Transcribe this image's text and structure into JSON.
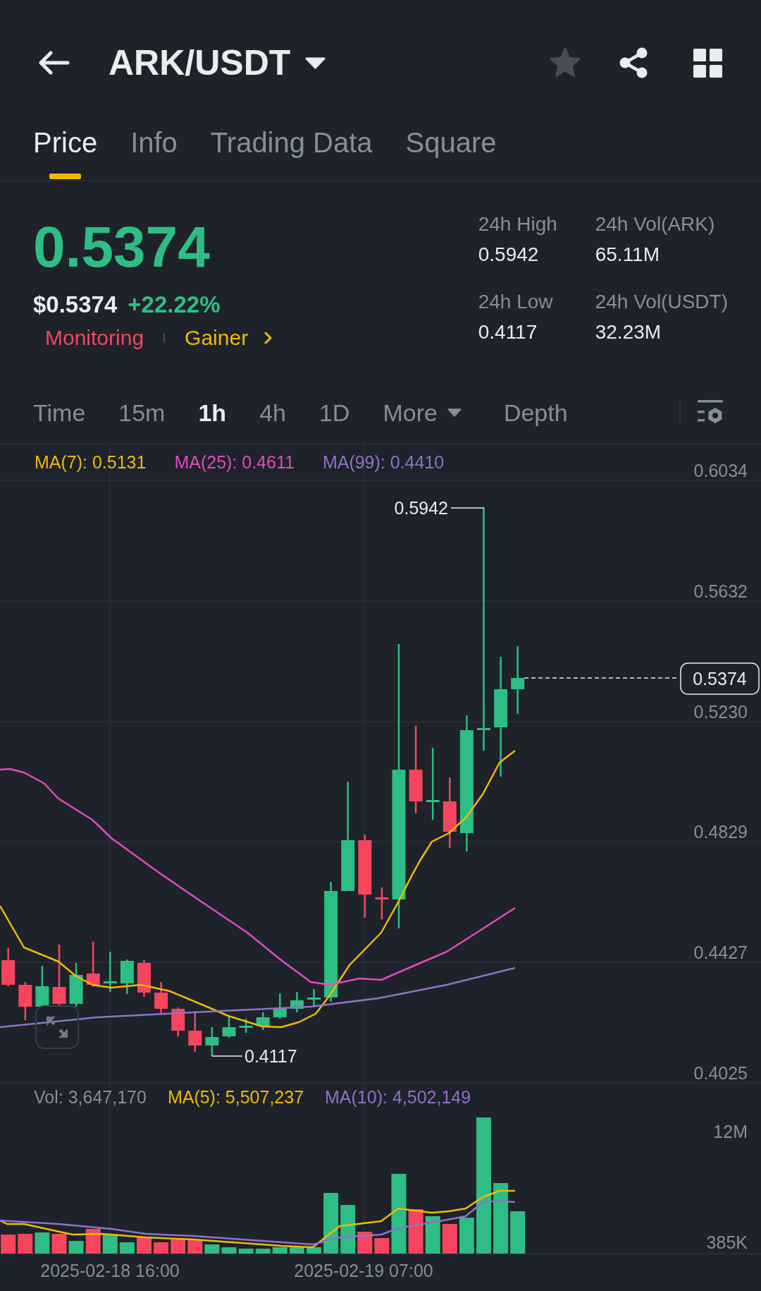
{
  "header": {
    "title": "ARK/USDT",
    "favorite": false
  },
  "tabs": [
    {
      "label": "Price",
      "selected": true
    },
    {
      "label": "Info",
      "selected": false
    },
    {
      "label": "Trading Data",
      "selected": false
    },
    {
      "label": "Square",
      "selected": false
    }
  ],
  "ticker": {
    "last_price": "0.5374",
    "usd_price": "$0.5374",
    "change": "+22.22%",
    "tags": [
      {
        "label": "Monitoring",
        "color": "#f6465d",
        "kind": "tag"
      },
      {
        "label": "Gainer",
        "color": "#f0b90b",
        "kind": "link"
      }
    ]
  },
  "stats": [
    {
      "label": "24h High",
      "value": "0.5942"
    },
    {
      "label": "24h Vol(ARK)",
      "value": "65.11M"
    },
    {
      "label": "24h Low",
      "value": "0.4117"
    },
    {
      "label": "24h Vol(USDT)",
      "value": "32.23M"
    }
  ],
  "intervals": [
    {
      "label": "Time",
      "kind": "interval",
      "selected": false
    },
    {
      "label": "15m",
      "kind": "interval",
      "selected": false
    },
    {
      "label": "1h",
      "kind": "interval",
      "selected": true
    },
    {
      "label": "4h",
      "kind": "interval",
      "selected": false
    },
    {
      "label": "1D",
      "kind": "interval",
      "selected": false
    },
    {
      "label": "More",
      "kind": "dropdown",
      "selected": false
    },
    {
      "label": "Depth",
      "kind": "view",
      "selected": false
    }
  ],
  "price_chart": {
    "legend": [
      {
        "label": "MA(7): 0.5131",
        "color": "#f0b90b"
      },
      {
        "label": "MA(25): 0.4611",
        "color": "#e04cbc"
      },
      {
        "label": "MA(99): 0.4410",
        "color": "#8e72c9"
      }
    ],
    "y_axis": [
      "0.6034",
      "0.5632",
      "0.5230",
      "0.4829",
      "0.4427",
      "0.4025"
    ],
    "high_label": "0.5942",
    "low_label": "0.4117",
    "last_price_tag": "0.5374"
  },
  "volume_chart": {
    "legend": [
      {
        "label": "Vol: 3,647,170",
        "color": "#848e9c"
      },
      {
        "label": "MA(5): 5,507,237",
        "color": "#f0b90b"
      },
      {
        "label": "MA(10): 4,502,149",
        "color": "#8e72c9"
      }
    ],
    "y_axis": [
      "12M",
      "385K"
    ],
    "x_axis": [
      "2025-02-18 16:00",
      "2025-02-19 07:00"
    ]
  }
}
